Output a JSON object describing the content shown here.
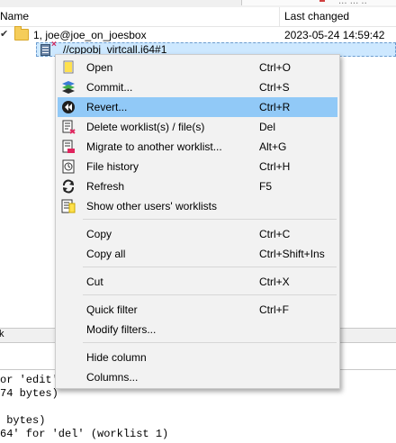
{
  "tree": {
    "columns": {
      "name": "Name",
      "last_changed": "Last changed"
    },
    "ghost_text": "... ... ..",
    "rows": [
      {
        "name": "1, joe@joe_on_joesbox",
        "date": "2023-05-24 14:59:42"
      },
      {
        "name": "//cppobj_virtcall.i64#1"
      }
    ]
  },
  "menu": {
    "items": [
      {
        "label": "Open",
        "shortcut": "Ctrl+O",
        "icon": "open-icon"
      },
      {
        "label": "Commit...",
        "shortcut": "Ctrl+S",
        "icon": "commit-icon"
      },
      {
        "label": "Revert...",
        "shortcut": "Ctrl+R",
        "icon": "revert-icon",
        "highlighted": true
      },
      {
        "label": "Delete worklist(s) / file(s)",
        "shortcut": "Del",
        "icon": "delete-icon"
      },
      {
        "label": "Migrate to another worklist...",
        "shortcut": "Alt+G",
        "icon": "migrate-icon"
      },
      {
        "label": "File history",
        "shortcut": "Ctrl+H",
        "icon": "history-icon"
      },
      {
        "label": "Refresh",
        "shortcut": "F5",
        "icon": "refresh-icon"
      },
      {
        "label": "Show other users' worklists",
        "shortcut": "",
        "icon": "users-worklists-icon"
      },
      {
        "label": "Copy",
        "shortcut": "Ctrl+C"
      },
      {
        "label": "Copy all",
        "shortcut": "Ctrl+Shift+Ins"
      },
      {
        "label": "Cut",
        "shortcut": "Ctrl+X"
      },
      {
        "label": "Quick filter",
        "shortcut": "Ctrl+F"
      },
      {
        "label": "Modify filters..."
      },
      {
        "label": "Hide column"
      },
      {
        "label": "Columns..."
      }
    ]
  },
  "log": {
    "tab_mark": "k",
    "lines": [
      "or 'edit'",
      "74 bytes)",
      "",
      " bytes)",
      "64' for 'del' (worklist 1)"
    ]
  },
  "colors": {
    "menu_bg": "#f2f2f2",
    "menu_highlight": "#91c9f7",
    "selection": "#cde8ff",
    "folder": "#f5cd5a"
  }
}
